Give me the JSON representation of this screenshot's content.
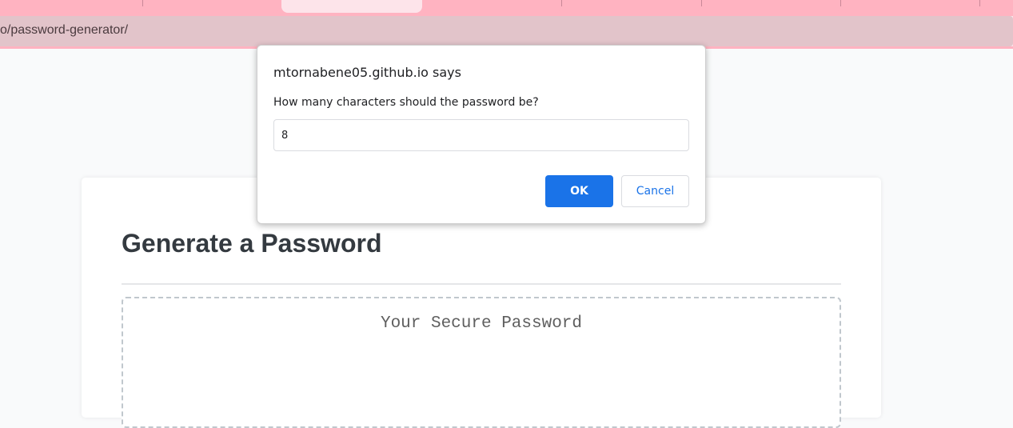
{
  "browser": {
    "address_bar_url": "o/password-generator/",
    "tab_strip_color": "#ffb3c1",
    "active_tab_color": "#fde4ea"
  },
  "page": {
    "card_title": "Generate a Password",
    "password_placeholder": "Your Secure Password"
  },
  "dialog": {
    "title": "mtornabene05.github.io says",
    "message": "How many characters should the password be?",
    "input_value": "8",
    "ok_label": "OK",
    "cancel_label": "Cancel",
    "accent_color": "#1a73e8"
  }
}
